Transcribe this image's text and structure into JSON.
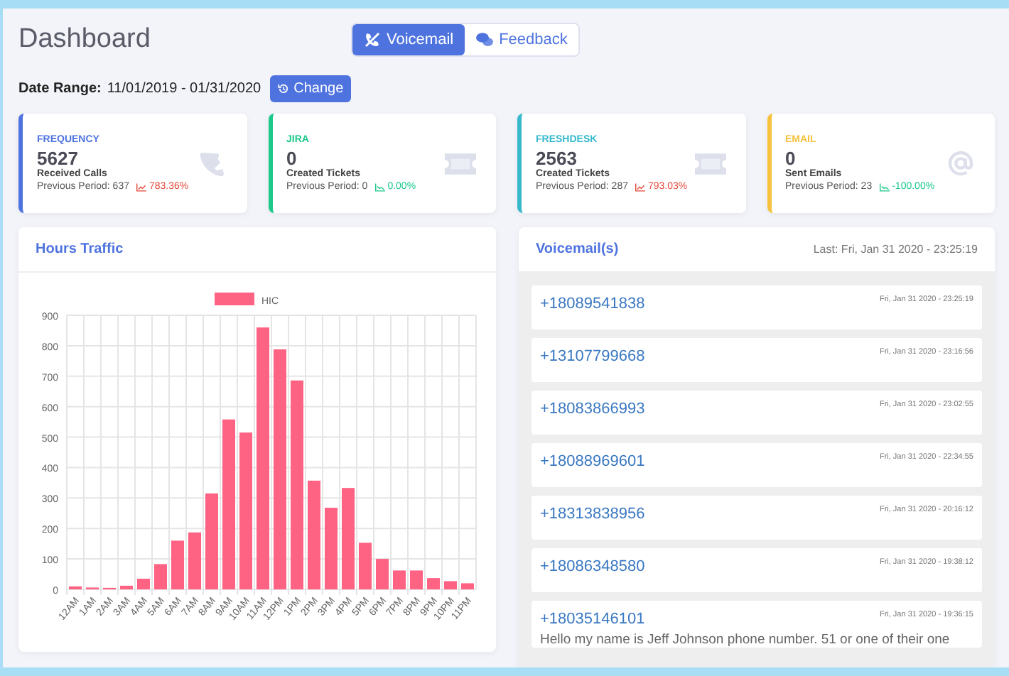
{
  "header": {
    "title": "Dashboard",
    "tabs": [
      {
        "label": "Voicemail",
        "kind": "voicemail",
        "selected": true
      },
      {
        "label": "Feedback",
        "kind": "feedback",
        "selected": false
      }
    ]
  },
  "date_range": {
    "label": "Date Range:",
    "value": "11/01/2019 - 01/31/2020",
    "button": "Change"
  },
  "stats": [
    {
      "title": "FREQUENCY",
      "color": "#4e73df",
      "kind": "calls",
      "value": "5627",
      "caption": "Received Calls",
      "previous": "Previous Period: 637",
      "change": "783.36%",
      "increase": true
    },
    {
      "title": "JIRA",
      "color": "#1cc88a",
      "kind": "tickets",
      "value": "0",
      "caption": "Created Tickets",
      "previous": "Previous Period: 0",
      "change": "0.00%",
      "increase": false
    },
    {
      "title": "FRESHDESK",
      "color": "#36b9cc",
      "kind": "tickets",
      "value": "2563",
      "caption": "Created Tickets",
      "previous": "Previous Period: 287",
      "change": "793.03%",
      "increase": true
    },
    {
      "title": "EMAIL",
      "color": "#f6c23e",
      "kind": "emails",
      "value": "0",
      "caption": "Sent Emails",
      "previous": "Previous Period: 23",
      "change": "-100.00%",
      "increase": false
    }
  ],
  "traffic": {
    "title": "Hours Traffic",
    "chart_data": {
      "type": "bar",
      "categories": [
        "12AM",
        "1AM",
        "2AM",
        "3AM",
        "4AM",
        "5AM",
        "6AM",
        "7AM",
        "8AM",
        "9AM",
        "10AM",
        "11AM",
        "12PM",
        "1PM",
        "2PM",
        "3PM",
        "4PM",
        "5PM",
        "6PM",
        "7PM",
        "8PM",
        "9PM",
        "10PM",
        "11PM"
      ],
      "series": [
        {
          "name": "HIC",
          "color": "#ff6384",
          "values": [
            10,
            6,
            5,
            12,
            35,
            83,
            160,
            187,
            315,
            558,
            515,
            860,
            788,
            686,
            357,
            268,
            333,
            153,
            100,
            62,
            62,
            37,
            27,
            20
          ]
        }
      ],
      "ylim": [
        0,
        900
      ],
      "grid": true,
      "yticks": [
        0,
        100,
        200,
        300,
        400,
        500,
        600,
        700,
        800,
        900
      ]
    }
  },
  "voicemails": {
    "title": "Voicemail(s)",
    "last": "Last: Fri, Jan 31 2020 - 23:25:19",
    "items": [
      {
        "number": "+18089541838",
        "time": "Fri, Jan 31 2020 - 23:25:19"
      },
      {
        "number": "+13107799668",
        "time": "Fri, Jan 31 2020 - 23:16:56"
      },
      {
        "number": "+18083866993",
        "time": "Fri, Jan 31 2020 - 23:02:55"
      },
      {
        "number": "+18088969601",
        "time": "Fri, Jan 31 2020 - 22:34:55"
      },
      {
        "number": "+18313838956",
        "time": "Fri, Jan 31 2020 - 20:16:12"
      },
      {
        "number": "+18086348580",
        "time": "Fri, Jan 31 2020 - 19:38:12"
      },
      {
        "number": "+18035146101",
        "time": "Fri, Jan 31 2020 - 19:36:15",
        "message": "Hello my name is Jeff Johnson phone number. 51 or one of their one"
      }
    ]
  }
}
